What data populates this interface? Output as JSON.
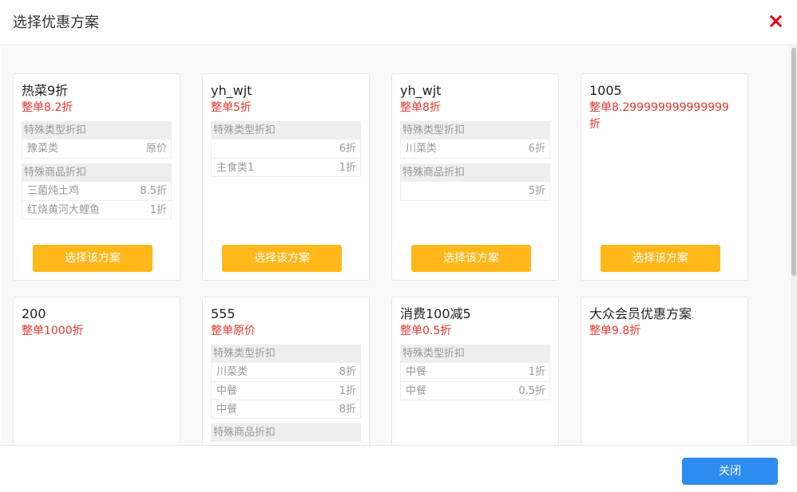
{
  "dialog": {
    "title": "选择优惠方案",
    "close_button_label": "关闭",
    "choose_button_label": "选择该方案"
  },
  "colors": {
    "accent_orange": "#ffb71a",
    "discount_red": "#e6362e",
    "close_blue": "#2d8cf0",
    "close_icon_red": "#e60012"
  },
  "icons": {
    "close": "close-x-icon"
  },
  "plans": [
    {
      "name": "热菜9折",
      "discount": "整单8.2折",
      "sections": [
        {
          "title": "特殊类型折扣",
          "rows": [
            {
              "label": "豫菜类",
              "value": "原价"
            }
          ]
        },
        {
          "title": "特殊商品折扣",
          "rows": [
            {
              "label": "三菌炖土鸡",
              "value": "8.5折"
            },
            {
              "label": "红烧黄河大鲤鱼",
              "value": "1折"
            }
          ]
        }
      ]
    },
    {
      "name": "yh_wjt",
      "discount": "整单5折",
      "sections": [
        {
          "title": "特殊类型折扣",
          "rows": [
            {
              "label": "",
              "value": "6折"
            },
            {
              "label": "主食类1",
              "value": "1折"
            }
          ]
        }
      ]
    },
    {
      "name": "yh_wjt",
      "discount": "整单8折",
      "sections": [
        {
          "title": "特殊类型折扣",
          "rows": [
            {
              "label": "川菜类",
              "value": "6折"
            }
          ]
        },
        {
          "title": "特殊商品折扣",
          "rows": [
            {
              "label": "",
              "value": "5折"
            }
          ]
        }
      ]
    },
    {
      "name": "1005",
      "discount": "整单8.299999999999999折",
      "sections": []
    },
    {
      "name": "200",
      "discount": "整单1000折",
      "sections": []
    },
    {
      "name": "555",
      "discount": "整单原价",
      "sections": [
        {
          "title": "特殊类型折扣",
          "rows": [
            {
              "label": "川菜类",
              "value": "8折"
            },
            {
              "label": "中餐",
              "value": "1折"
            },
            {
              "label": "中餐",
              "value": "8折"
            }
          ]
        },
        {
          "title": "特殊商品折扣",
          "rows": []
        }
      ]
    },
    {
      "name": "消费100减5",
      "discount": "整单0.5折",
      "sections": [
        {
          "title": "特殊类型折扣",
          "rows": [
            {
              "label": "中餐",
              "value": "1折"
            },
            {
              "label": "中餐",
              "value": "0.5折"
            }
          ]
        }
      ]
    },
    {
      "name": "大众会员优惠方案",
      "discount": "整单9.8折",
      "sections": []
    }
  ]
}
